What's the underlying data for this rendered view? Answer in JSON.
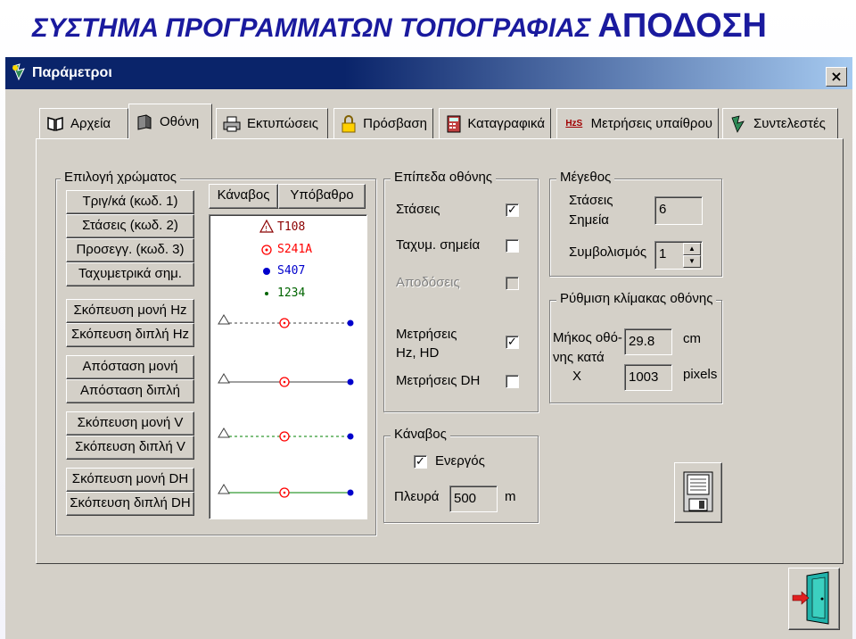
{
  "slide": {
    "title_prefix": "ΣΥΣΤΗΜΑ ΠΡΟΓΡΑΜΜΑΤΩΝ ΤΟΠΟΓΡΑΦΙΑΣ",
    "title_suffix": "ΑΠΟΔΟΣΗ"
  },
  "window": {
    "title": "Παράμετροι",
    "close_label": "×"
  },
  "tabs": [
    {
      "label": "Αρχεία",
      "icon": "book-icon"
    },
    {
      "label": "Οθόνη",
      "icon": "monitor-icon"
    },
    {
      "label": "Εκτυπώσεις",
      "icon": "printer-icon"
    },
    {
      "label": "Πρόσβαση",
      "icon": "lock-icon"
    },
    {
      "label": "Καταγραφικά",
      "icon": "calculator-icon"
    },
    {
      "label": "Μετρήσεις υπαίθρου",
      "icon": "hz-icon",
      "icon_text": "HzS"
    },
    {
      "label": "Συντελεστές",
      "icon": "theodolite-icon"
    }
  ],
  "active_tab": "Οθόνη",
  "color_group": {
    "legend": "Επιλογή χρώματος",
    "buttons": [
      "Τριγ/κά (κωδ. 1)",
      "Στάσεις (κωδ. 2)",
      "Προσεγγ. (κωδ. 3)",
      "Ταχυμετρικά σημ.",
      "Σκόπευση μονή Hz",
      "Σκόπευση διπλή Hz",
      "Απόσταση μονή",
      "Απόσταση διπλή",
      "Σκόπευση μονή V",
      "Σκόπευση διπλή V",
      "Σκόπευση μονή DH",
      "Σκόπευση διπλή DH"
    ],
    "grid_button": "Κάναβος",
    "background_button": "Υπόβαθρο",
    "preview_points": [
      {
        "label": "T108",
        "color": "#8b0000",
        "icon": "triangle-icon"
      },
      {
        "label": "S241A",
        "color": "#ff0000",
        "icon": "circle-target-icon"
      },
      {
        "label": "S407",
        "color": "#0000cc",
        "icon": "dot-icon"
      },
      {
        "label": "1234",
        "color": "#006400",
        "icon": "small-dot-icon"
      }
    ],
    "preview_lines": [
      {
        "style": "dashed",
        "color": "#404040"
      },
      {
        "style": "solid",
        "color": "#404040"
      },
      {
        "style": "dashed",
        "color": "#008000"
      },
      {
        "style": "solid",
        "color": "#008000"
      }
    ]
  },
  "screen_levels": {
    "legend": "Επίπεδα οθόνης",
    "items": [
      {
        "label": "Στάσεις",
        "checked": true,
        "enabled": true
      },
      {
        "label": "Ταχυμ. σημεία",
        "checked": false,
        "enabled": true
      },
      {
        "label": "Αποδόσεις",
        "checked": false,
        "enabled": false
      },
      {
        "label": "Μετρήσεις",
        "label2": "Hz, HD",
        "checked": true,
        "enabled": true
      },
      {
        "label": "Μετρήσεις DH",
        "checked": false,
        "enabled": true
      }
    ]
  },
  "grid": {
    "legend": "Κάναβος",
    "enable_label": "Ενεργός",
    "enabled": true,
    "side_label": "Πλευρά",
    "side_value": "500",
    "side_unit": "m"
  },
  "size": {
    "legend": "Μέγεθος",
    "stations_label1": "Στάσεις",
    "stations_label2": "Σημεία",
    "stations_value": "6",
    "symbol_label": "Συμβολισμός",
    "symbol_value": "1"
  },
  "scale": {
    "legend": "Ρύθμιση κλίμακας οθόνης",
    "length_label1": "Μήκος οθό-",
    "length_label2": "νης κατά",
    "length_label3": "X",
    "length_value": "29.8",
    "length_unit": "cm",
    "pixels_value": "1003",
    "pixels_unit": "pixels"
  }
}
